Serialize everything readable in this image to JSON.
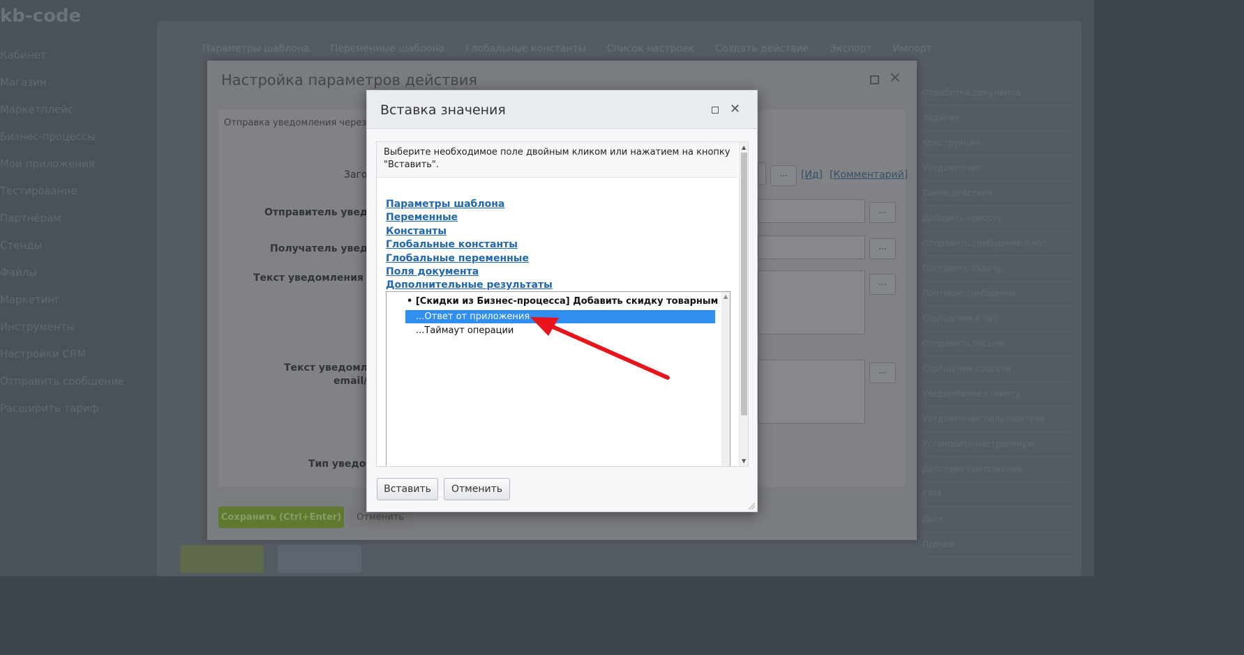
{
  "background": {
    "logo": "kb-code",
    "left_nav": [
      "Кабинет",
      "Магазин",
      "Маркетплейс",
      "Бизнес-процессы",
      "Мои приложения",
      "Тестирование",
      "Партнёрам",
      "Стенды",
      "Файлы",
      "Маркетинг",
      "Инструменты",
      "Настройки CRM",
      "Отправить сообщение",
      "Расширить тариф"
    ],
    "top_tabs": [
      "Параметры шаблона",
      "Переменные шаблона",
      "Глобальные константы",
      "Список настроек",
      "Создать действие",
      "Экспорт",
      "Импорт"
    ],
    "right_list": [
      "Обработка документа",
      "Задания",
      "Конструкции",
      "Уведомления",
      "Такие действия",
      "Добавить новость",
      "Отправить сообщение в чат",
      "Поставить задачу",
      "Почтовое сообщение",
      "Сообщение в чат",
      "Отправить письмо",
      "Сообщение соцсети",
      "Уведомление клиенту",
      "Уведомление пользователя",
      "Установить настроенную",
      "Действия приложений",
      "CRM",
      "Диск",
      "Прочее"
    ]
  },
  "parent_dialog": {
    "title": "Настройка параметров действия",
    "subtitle": "Отправка уведомления через мо",
    "labels": {
      "title_field": "Заго",
      "sender": "Отправитель уведомл",
      "recipient": "Получатель уведом",
      "text": "Текст уведомления для",
      "email_text": "Текст уведомлен",
      "email_text_2": "email/ja",
      "type": "Тип уведом"
    },
    "links": [
      "[Ид]",
      "[Комментарий]"
    ],
    "dots": "...",
    "save_button": "Сохранить (Ctrl+Enter)",
    "cancel_button": "Отменить"
  },
  "dialog": {
    "title": "Вставка значения",
    "info_text": "Выберите необходимое поле двойным кликом или нажатием на кнопку \"Вставить\".",
    "links": [
      "Параметры шаблона",
      "Переменные",
      "Константы",
      "Глобальные константы",
      "Глобальные переменные",
      "Поля документа",
      "Дополнительные результаты"
    ],
    "tree": {
      "group_label": "• [Скидки из Бизнес-процесса] Добавить скидку товарным пози",
      "items": [
        "...Ответ от приложения",
        "...Таймаут операции"
      ],
      "selected_index": 0
    },
    "insert_button": "Вставить",
    "cancel_button": "Отменить"
  },
  "colors": {
    "selection": "#2f8ef0",
    "link": "#2067b0",
    "arrow": "#e8141c"
  }
}
